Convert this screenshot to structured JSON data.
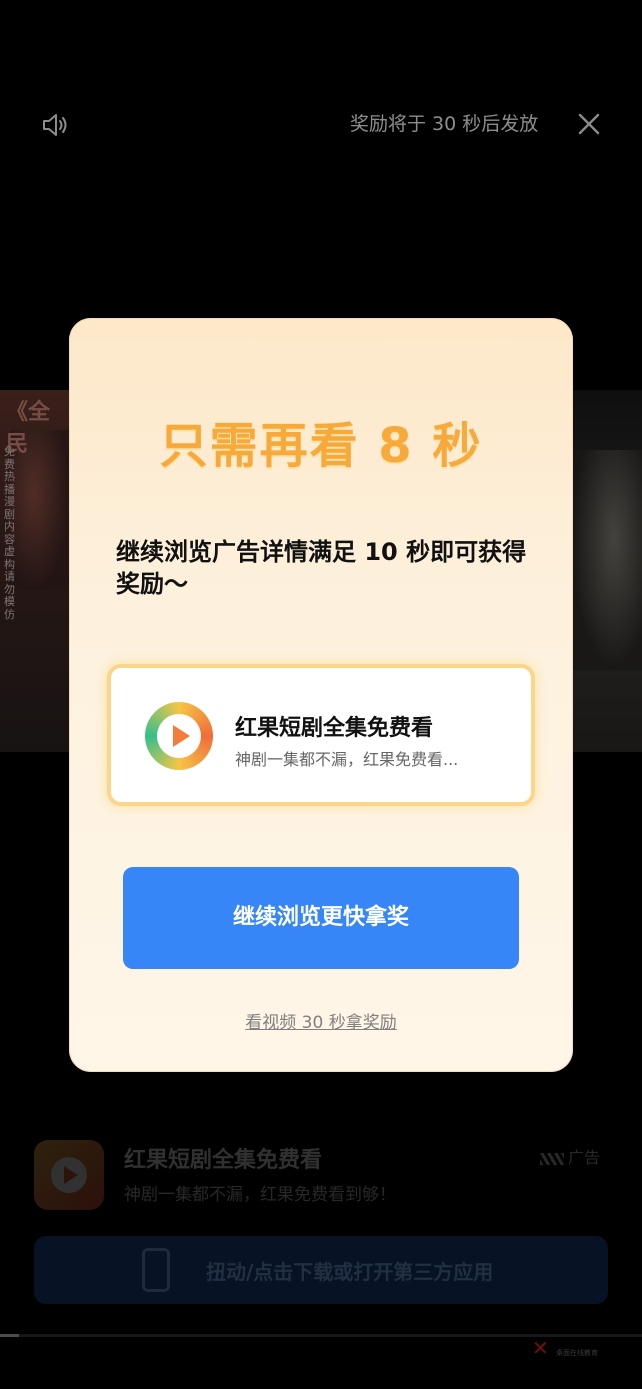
{
  "topbar": {
    "sound_icon": "speaker-icon",
    "reward_text": "奖励将于 30 秒后发放",
    "close_icon": "close-icon"
  },
  "video": {
    "title": "《全民",
    "side_text": "免费热播漫剧内容虚构请勿模仿"
  },
  "dialog": {
    "title": "只需再看 8 秒",
    "description": "继续浏览广告详情满足 10 秒即可获得奖励～",
    "card": {
      "icon": "play-icon",
      "title": "红果短剧全集免费看",
      "subtitle": "神剧一集都不漏，红果免费看..."
    },
    "cta_label": "继续浏览更快拿奖",
    "link_label": "看视频 30 秒拿奖励"
  },
  "bottom_ad": {
    "title": "红果短剧全集免费看",
    "subtitle": "神剧一集都不漏，红果免费看到够！",
    "badge": "广告",
    "download_label": "扭动/点击下载或打开第三方应用"
  },
  "progress": {
    "value": 0.03
  },
  "watermark": {
    "text": "桌面在线教育"
  },
  "colors": {
    "title_orange": "#f7a93a",
    "cta_blue": "#3786f7",
    "dialog_bg": "#fdf1de"
  }
}
